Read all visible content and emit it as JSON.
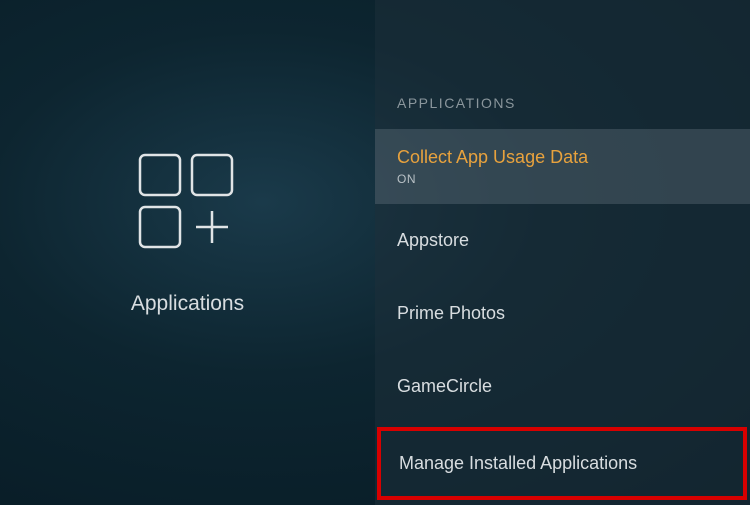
{
  "leftPanel": {
    "title": "Applications"
  },
  "rightPanel": {
    "header": "APPLICATIONS",
    "items": [
      {
        "label": "Collect App Usage Data",
        "sublabel": "ON",
        "selected": true
      },
      {
        "label": "Appstore"
      },
      {
        "label": "Prime Photos"
      },
      {
        "label": "GameCircle"
      },
      {
        "label": "Manage Installed Applications",
        "highlighted": true
      }
    ]
  }
}
